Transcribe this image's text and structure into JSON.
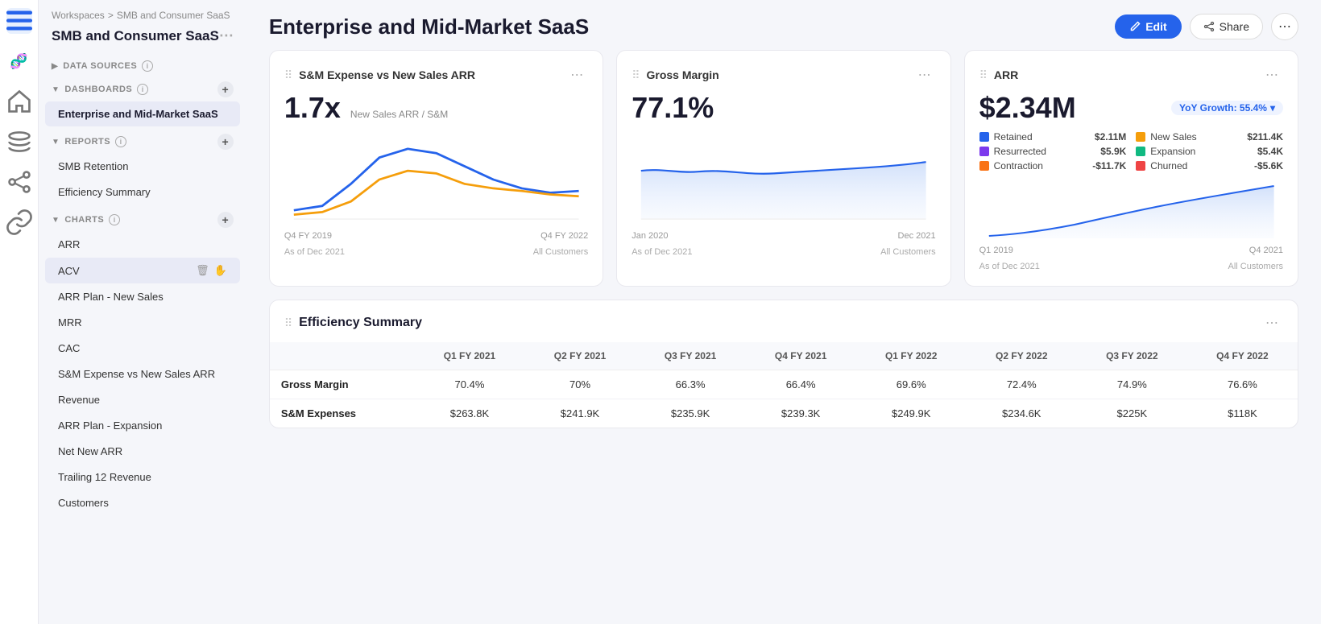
{
  "breadcrumb": {
    "workspace": "Workspaces",
    "sep": ">",
    "current": "SMB and Consumer SaaS"
  },
  "sidebar": {
    "workspace_title": "SMB and Consumer SaaS",
    "sections": {
      "data_sources": "DATA SOURCES",
      "dashboards": "DASHBOARDS",
      "reports": "REPORTS",
      "charts": "CHARTS"
    },
    "active_dashboard": "Enterprise and Mid-Market SaaS",
    "reports": [
      "SMB Retention",
      "Efficiency Summary"
    ],
    "charts": [
      "ARR",
      "ACV",
      "ARR Plan - New Sales",
      "MRR",
      "CAC",
      "S&M Expense vs New Sales ARR",
      "Revenue",
      "ARR Plan - Expansion",
      "Net New ARR",
      "Trailing 12 Revenue",
      "Customers"
    ]
  },
  "main": {
    "title": "Enterprise and Mid-Market SaaS",
    "edit_label": "Edit",
    "share_label": "Share",
    "more_icon": "⋯"
  },
  "cards": {
    "sm_expense": {
      "title": "S&M Expense vs New Sales ARR",
      "value": "1.7x",
      "sub": "New Sales ARR / S&M",
      "x_start": "Q4 FY 2019",
      "x_end": "Q4 FY 2022",
      "footer_left": "As of Dec 2021",
      "footer_right": "All Customers"
    },
    "gross_margin": {
      "title": "Gross Margin",
      "value": "77.1%",
      "x_start": "Jan 2020",
      "x_end": "Dec 2021",
      "footer_left": "As of Dec 2021",
      "footer_right": "All Customers"
    },
    "arr": {
      "title": "ARR",
      "value": "$2.34M",
      "yoy_label": "YoY Growth: 55.4%",
      "x_start": "Q1 2019",
      "x_end": "Q4 2021",
      "footer_left": "As of Dec 2021",
      "footer_right": "All Customers",
      "legend": [
        {
          "label": "Retained",
          "color": "#2563eb",
          "value": "$2.11M"
        },
        {
          "label": "New Sales",
          "color": "#f59e0b",
          "value": "$211.4K"
        },
        {
          "label": "Resurrected",
          "color": "#7c3aed",
          "value": "$5.9K"
        },
        {
          "label": "Expansion",
          "color": "#10b981",
          "value": "$5.4K"
        },
        {
          "label": "Contraction",
          "color": "#f97316",
          "value": "-$11.7K"
        },
        {
          "label": "Churned",
          "color": "#ef4444",
          "value": "-$5.6K"
        }
      ]
    }
  },
  "efficiency": {
    "title": "Efficiency Summary",
    "columns": [
      "",
      "Q1 FY 2021",
      "Q2 FY 2021",
      "Q3 FY 2021",
      "Q4 FY 2021",
      "Q1 FY 2022",
      "Q2 FY 2022",
      "Q3 FY 2022",
      "Q4 FY 2022"
    ],
    "rows": [
      {
        "label": "Gross Margin",
        "values": [
          "70.4%",
          "70%",
          "66.3%",
          "66.4%",
          "69.6%",
          "72.4%",
          "74.9%",
          "76.6%"
        ]
      },
      {
        "label": "S&M Expenses",
        "values": [
          "$263.8K",
          "$241.9K",
          "$235.9K",
          "$239.3K",
          "$249.9K",
          "$234.6K",
          "$225K",
          "$118K"
        ]
      }
    ]
  }
}
